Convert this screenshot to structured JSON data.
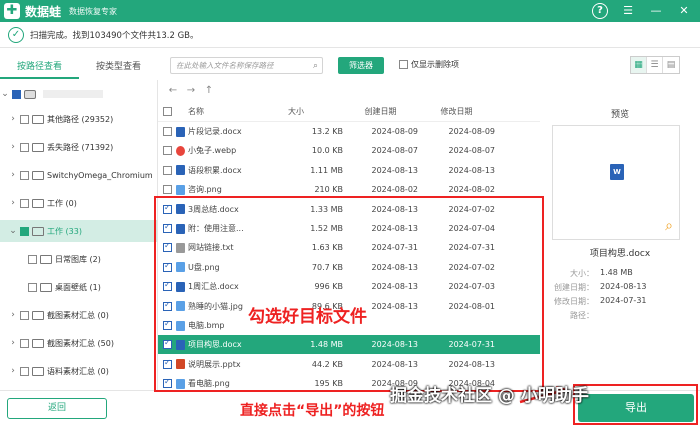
{
  "app": {
    "name": "数据蛙",
    "subtitle": "数据恢复专家",
    "logo_char": "✚"
  },
  "window_controls": {
    "help": "?",
    "menu": "☰",
    "min": "—",
    "close": "✕"
  },
  "status": {
    "text": "扫描完成。找到103490个文件共13.2 GB。"
  },
  "tabs": [
    {
      "label": "按路径查看",
      "active": true
    },
    {
      "label": "按类型查看",
      "active": false
    }
  ],
  "search": {
    "placeholder": "在此处输入文件名称保存路径"
  },
  "filter_button": "筛选器",
  "only_deleted_label": "仅显示删除项",
  "tree": [
    {
      "label": "其他路径 (29352)"
    },
    {
      "label": "丢失路径 (71392)"
    },
    {
      "label": "SwitchyOmega_Chromium"
    },
    {
      "label": "工作 (0)"
    },
    {
      "label": "工作 (33)"
    },
    {
      "label": "日常图库 (2)"
    },
    {
      "label": "桌面壁纸 (1)"
    },
    {
      "label": "截图素材汇总 (0)"
    },
    {
      "label": "截图素材汇总 (50)"
    },
    {
      "label": "语料素材汇总 (0)"
    }
  ],
  "columns": {
    "name": "名称",
    "size": "大小",
    "created": "创建日期",
    "modified": "修改日期"
  },
  "files": [
    {
      "name": "片段记录.docx",
      "size": "13.2 KB",
      "created": "2024-08-09",
      "modified": "2024-08-09",
      "icon": "word",
      "checked": false
    },
    {
      "name": "小兔子.webp",
      "size": "10.0 KB",
      "created": "2024-08-07",
      "modified": "2024-08-07",
      "icon": "chrome",
      "checked": false
    },
    {
      "name": "语段积累.docx",
      "size": "1.11 MB",
      "created": "2024-08-13",
      "modified": "2024-08-13",
      "icon": "word",
      "checked": false
    },
    {
      "name": "咨询.png",
      "size": "210 KB",
      "created": "2024-08-02",
      "modified": "2024-08-02",
      "icon": "image",
      "checked": false
    },
    {
      "name": "3周总结.docx",
      "size": "1.33 MB",
      "created": "2024-08-13",
      "modified": "2024-07-02",
      "icon": "word",
      "checked": true
    },
    {
      "name": "附：使用注意...",
      "size": "1.52 MB",
      "created": "2024-08-13",
      "modified": "2024-07-04",
      "icon": "word",
      "checked": true
    },
    {
      "name": "网站链接.txt",
      "size": "1.63 KB",
      "created": "2024-07-31",
      "modified": "2024-07-31",
      "icon": "text",
      "checked": true
    },
    {
      "name": "U盘.png",
      "size": "70.7 KB",
      "created": "2024-08-13",
      "modified": "2024-07-02",
      "icon": "image",
      "checked": true
    },
    {
      "name": "1周汇总.docx",
      "size": "996 KB",
      "created": "2024-08-13",
      "modified": "2024-07-03",
      "icon": "word",
      "checked": true
    },
    {
      "name": "熟睡的小猫.jpg",
      "size": "89.6 KB",
      "created": "2024-08-13",
      "modified": "2024-08-01",
      "icon": "image",
      "checked": true
    },
    {
      "name": "电脑.bmp",
      "size": "",
      "created": "",
      "modified": "",
      "icon": "image",
      "checked": true
    },
    {
      "name": "项目构思.docx",
      "size": "1.48 MB",
      "created": "2024-08-13",
      "modified": "2024-07-31",
      "icon": "word",
      "checked": true,
      "selected": true
    },
    {
      "name": "说明展示.pptx",
      "size": "44.2 KB",
      "created": "2024-08-13",
      "modified": "2024-08-13",
      "icon": "ppt",
      "checked": true
    },
    {
      "name": "看电脑.png",
      "size": "195 KB",
      "created": "2024-08-09",
      "modified": "2024-08-04",
      "icon": "image",
      "checked": true
    }
  ],
  "preview": {
    "title": "预览",
    "doc_badge": "W",
    "file_name": "项目构思.docx",
    "meta": [
      {
        "k": "大小：",
        "v": "1.48 MB"
      },
      {
        "k": "创建日期：",
        "v": "2024-08-13"
      },
      {
        "k": "修改日期：",
        "v": "2024-07-31"
      },
      {
        "k": "路径：",
        "v": ""
      }
    ]
  },
  "back_button": "返回",
  "export_button": "导出",
  "annotations": {
    "select_files": "勾选好目标文件",
    "click_export": "直接点击“导出”的按钮"
  },
  "watermark": "掘金技术社区 @ 小明助手",
  "colors": {
    "brand": "#23a77c",
    "annotation": "#ee2222",
    "word": "#2a63b7"
  }
}
